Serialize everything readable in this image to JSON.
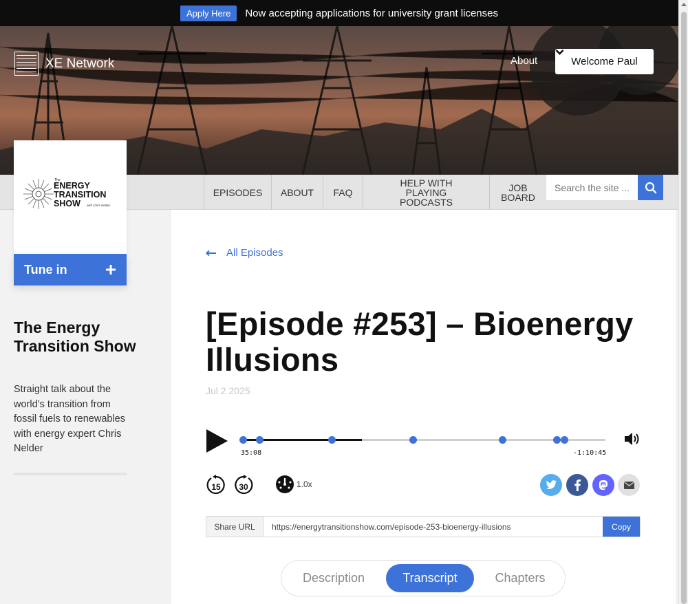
{
  "announcement": {
    "button": "Apply Here",
    "text": "Now accepting applications for university grant licenses"
  },
  "header": {
    "brand": "XE Network",
    "about": "About",
    "user_button": "Welcome Paul"
  },
  "nav": {
    "items": [
      "EPISODES",
      "ABOUT",
      "FAQ",
      "HELP WITH PLAYING PODCASTS",
      "JOB BOARD"
    ],
    "search_placeholder": "Search the site ..."
  },
  "sidebar": {
    "cover": {
      "the": "The",
      "line1": "ENERGY",
      "line2": "TRANSITION",
      "line3": "SHOW",
      "byline": "with Chris Nelder"
    },
    "tune_in": "Tune in",
    "show_title": "The Energy Transition Show",
    "show_description": "Straight talk about the world’s transition from fossil fuels to renewables with energy expert Chris Nelder"
  },
  "episode": {
    "back_link": "All Episodes",
    "title": "[Episode #253] – Bioenergy Illusions",
    "date": "Jul 2 2025"
  },
  "player": {
    "elapsed": "35:08",
    "remaining": "-1:10:45",
    "progress_fraction": 0.329,
    "chapter_marker_fractions": [
      0.0,
      0.046,
      0.245,
      0.469,
      0.716,
      0.866,
      0.887
    ],
    "skip_back": "15",
    "skip_forward": "30",
    "speed": "1.0x"
  },
  "share": {
    "label": "Share URL",
    "url": "https://energytransitionshow.com/episode-253-bioenergy-illusions",
    "copy": "Copy",
    "icons": [
      "twitter-icon",
      "facebook-icon",
      "mastodon-icon",
      "email-icon"
    ]
  },
  "tabs": {
    "items": [
      "Description",
      "Transcript",
      "Chapters"
    ],
    "active": "Transcript"
  },
  "colors": {
    "accent": "#3d73d8",
    "twitter": "#55acee",
    "facebook": "#3b5998",
    "mastodon": "#6364ff",
    "email": "#e0e0e0"
  }
}
